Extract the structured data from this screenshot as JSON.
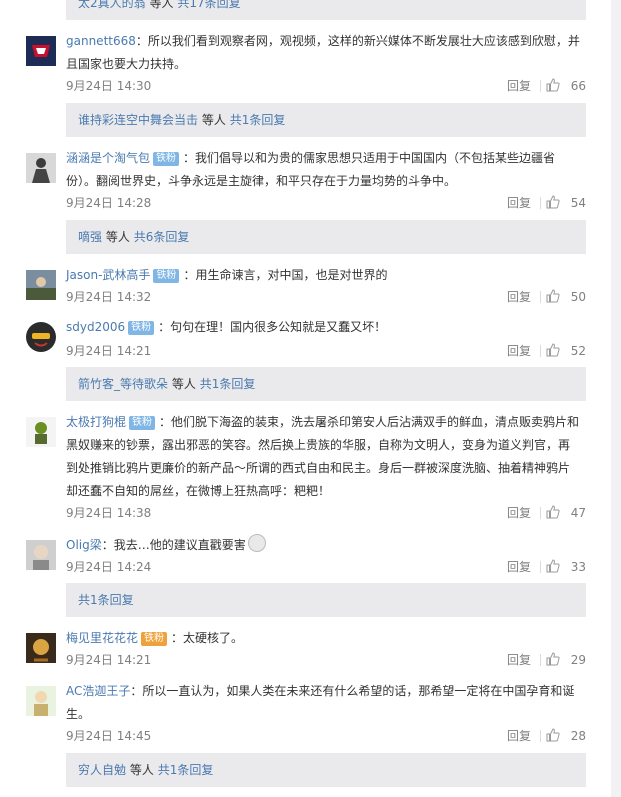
{
  "reply_bars": [
    {
      "users": "太2真人的翁",
      "suffix": "等人",
      "link": "共17条回复"
    },
    {
      "users": "谁持彩连空中舞会当击",
      "suffix": "等人",
      "link": "共1条回复"
    },
    {
      "users": "嘀强",
      "suffix": "等人",
      "link": "共6条回复"
    },
    {
      "users": "箭竹客_等待歌朵",
      "suffix": "等人",
      "link": "共1条回复"
    },
    {
      "users": "",
      "suffix": "",
      "link": "共1条回复"
    },
    {
      "users": "穷人自勉",
      "suffix": "等人",
      "link": "共1条回复"
    }
  ],
  "comments": [
    {
      "user": "gannett668",
      "badge": "",
      "sep": "：",
      "text": "所以我们看到观察者网，观视频，这样的新兴媒体不断发展壮大应该感到欣慰，并且国家也要大力扶持。",
      "time": "9月24日 14:30",
      "reply": "回复",
      "likes": "66"
    },
    {
      "user": "涵涵是个淘气包",
      "badge": "铁粉",
      "sep": "：",
      "text": "我们倡导以和为贵的儒家思想只适用于中国国内（不包括某些边疆省份）。翻阅世界史，斗争永远是主旋律，和平只存在于力量均势的斗争中。",
      "time": "9月24日 14:28",
      "reply": "回复",
      "likes": "54"
    },
    {
      "user": "Jason-武林高手",
      "badge": "铁粉",
      "sep": "：",
      "text": "用生命谏言，对中国，也是对世界的",
      "time": "9月24日 14:32",
      "reply": "回复",
      "likes": "50"
    },
    {
      "user": "sdyd2006",
      "badge": "铁粉",
      "sep": "：",
      "text": "句句在理！国内很多公知就是又蠢又坏！",
      "time": "9月24日 14:21",
      "reply": "回复",
      "likes": "52"
    },
    {
      "user": "太极打狗棍",
      "badge": "铁粉",
      "sep": "：",
      "text": "他们脱下海盗的装束，洗去屠杀印第安人后沾满双手的鲜血，清点贩卖鸦片和黑奴赚来的钞票，露出邪恶的笑容。然后换上贵族的华服，自称为文明人，变身为道义判官，再到处推销比鸦片更廉价的新产品～所谓的西式自由和民主。身后一群被深度洗脑、抽着精神鸦片却还蠢不自知的屌丝，在微博上狂热高呼：粑粑！",
      "time": "9月24日 14:38",
      "reply": "回复",
      "likes": "47"
    },
    {
      "user": "Olig梁",
      "badge": "",
      "sep": "：",
      "text": "我去…他的建议直戳要害",
      "time": "9月24日 14:24",
      "reply": "回复",
      "likes": "33"
    },
    {
      "user": "梅见里花花花",
      "badge": "铁粉",
      "sep": "：",
      "text": "太硬核了。",
      "time": "9月24日 14:21",
      "reply": "回复",
      "likes": "29"
    },
    {
      "user": "AC浩迦王子",
      "badge": "",
      "sep": "：",
      "text": "所以一直认为，如果人类在未来还有什么希望的话，那希望一定将在中国孕育和诞生。",
      "time": "9月24日 14:45",
      "reply": "回复",
      "likes": "28"
    }
  ],
  "colors": {
    "link": "#4a7ab0",
    "badge": "#7fb6e6",
    "reply_bg": "#eaeaec",
    "meta": "#808080"
  }
}
